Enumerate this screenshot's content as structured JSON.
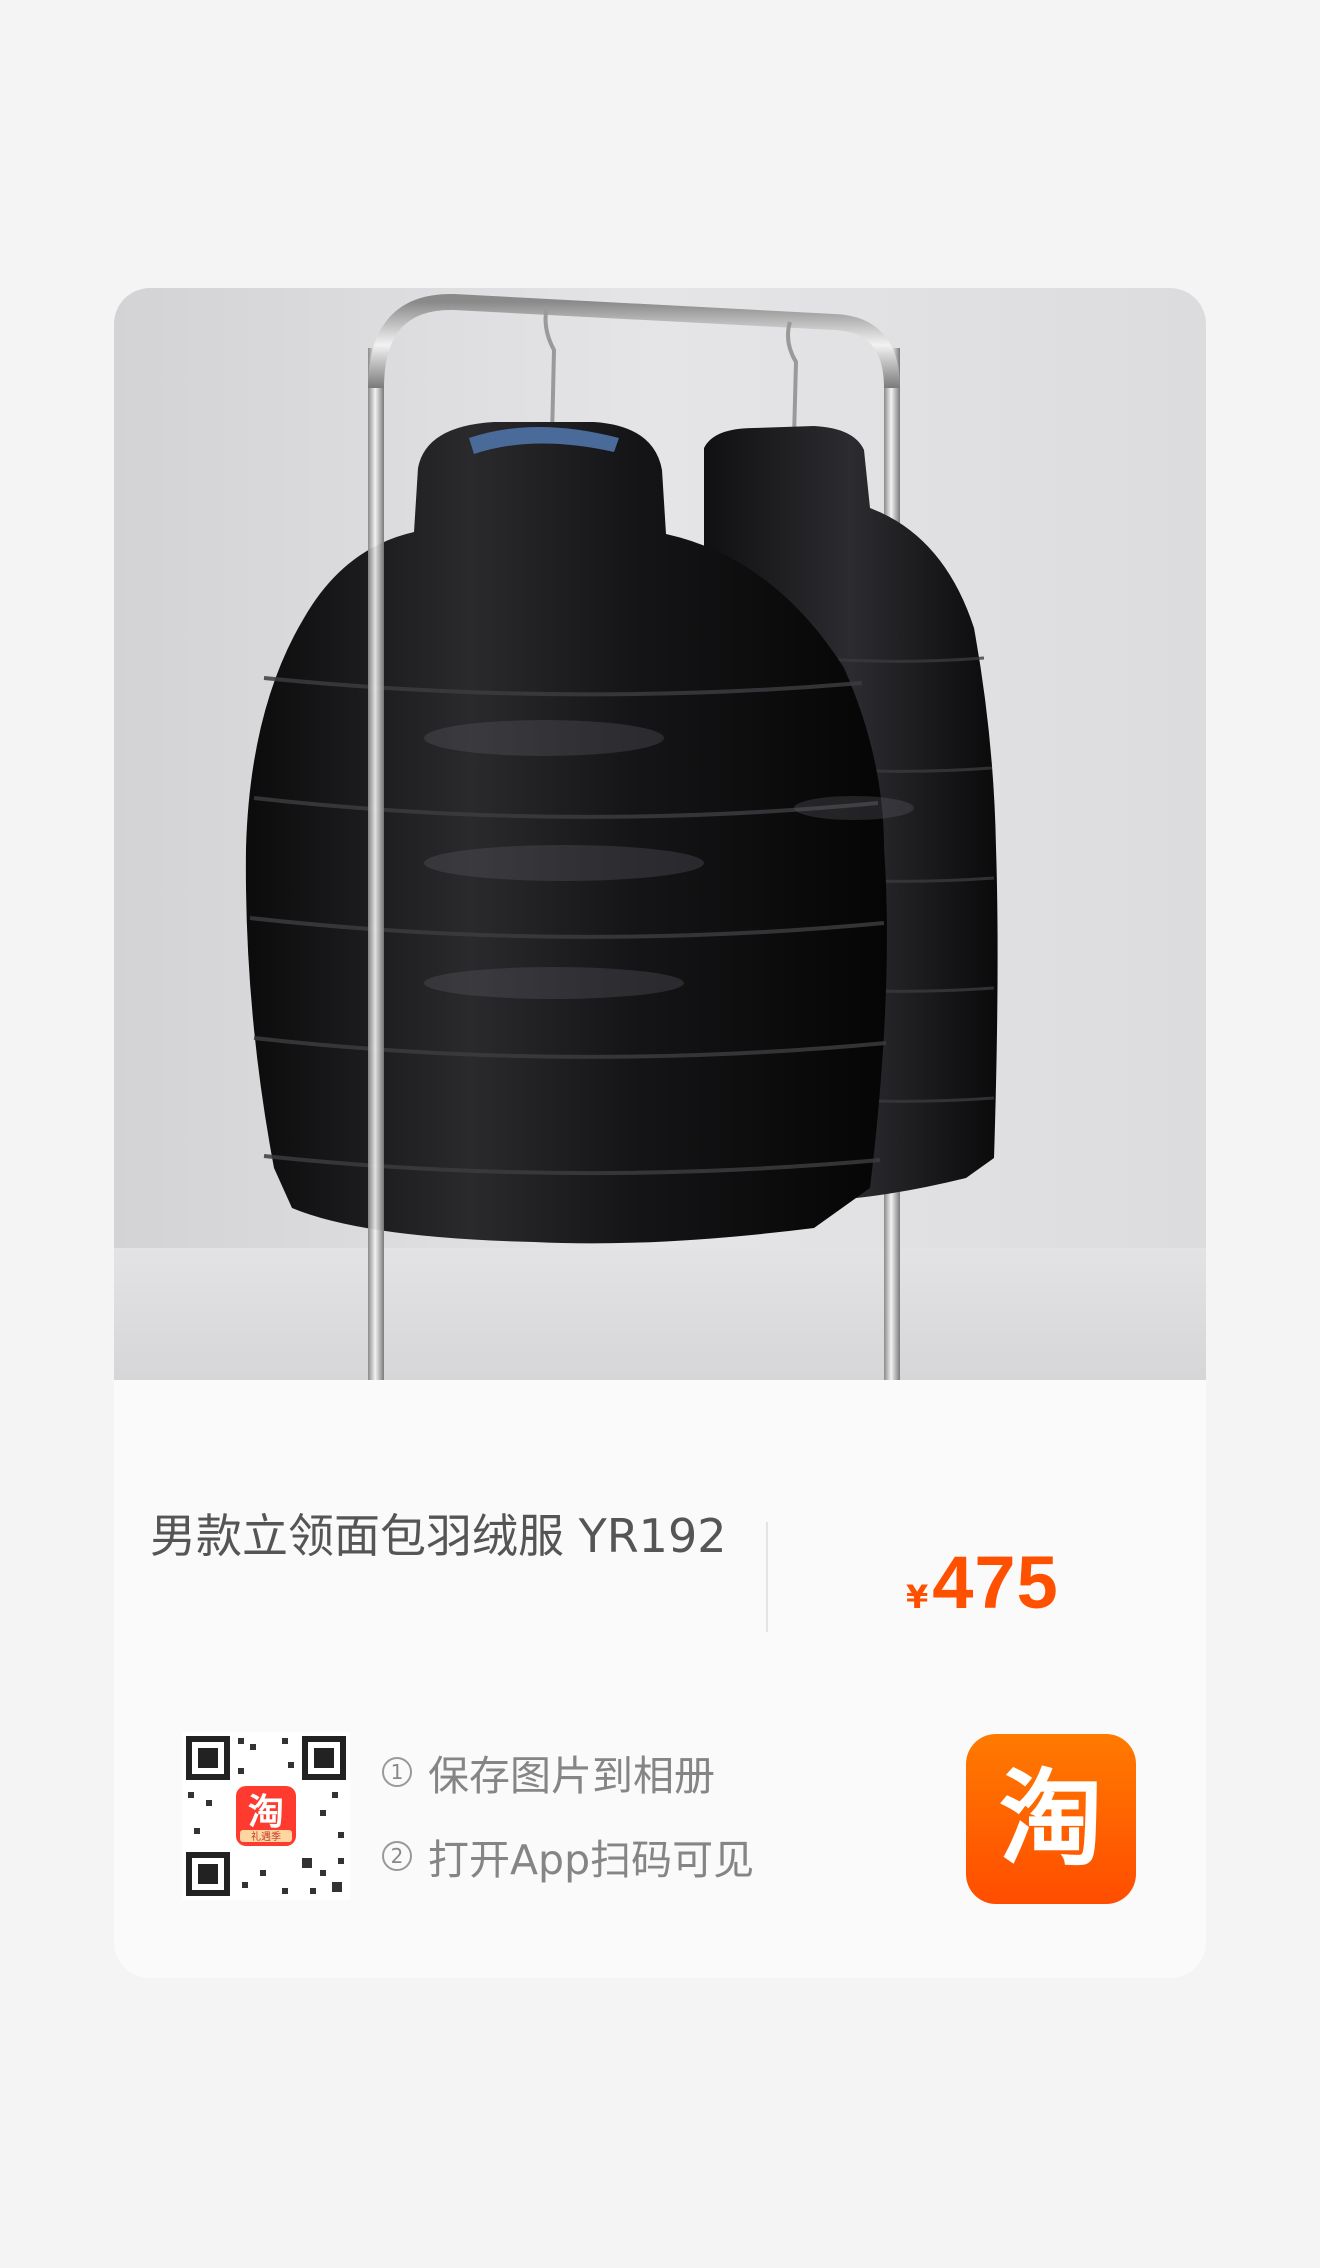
{
  "product": {
    "title": "男款立领面包羽绒服 YR192",
    "price_symbol": "¥",
    "price": "475"
  },
  "qr": {
    "badge_char": "淘",
    "badge_sub": "礼遇季"
  },
  "steps": [
    {
      "num": "1",
      "label": "保存图片到相册"
    },
    {
      "num": "2",
      "label": "打开App扫码可见"
    }
  ],
  "app_logo": {
    "char": "淘"
  },
  "colors": {
    "accent": "#ff5000",
    "logo_gradient_top": "#ff7a00",
    "logo_gradient_bottom": "#ff4d00"
  },
  "icons": [
    "product-photo",
    "qr-code-icon",
    "taobao-app-icon"
  ]
}
